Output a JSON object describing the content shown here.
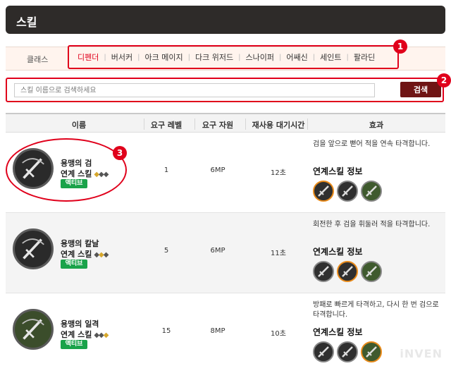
{
  "header": {
    "title": "스킬"
  },
  "classes": {
    "label": "클래스",
    "tabs": [
      "디펜더",
      "버서커",
      "아크 메이지",
      "다크 위저드",
      "스나이퍼",
      "어쌔신",
      "세인트",
      "팔라딘"
    ],
    "active_index": 0,
    "separator": "|"
  },
  "search": {
    "placeholder": "스킬 이름으로 검색하세요",
    "button_label": "검색"
  },
  "markers": [
    "1",
    "2",
    "3"
  ],
  "table": {
    "headers": [
      "이름",
      "요구 레벨",
      "요구 자원",
      "재사용 대기시간",
      "효과"
    ],
    "link_info_label": "연계스킬 정보",
    "rows": [
      {
        "name": "용맹의 검",
        "type": "연계 스킬",
        "badge": "액티브",
        "diamonds": [
          "gold",
          "gray",
          "gray"
        ],
        "level": "1",
        "resource": "6MP",
        "cooldown": "12초",
        "effect": "검을 앞으로 뻗어 적을 연속 타격합니다.",
        "selected_link": 0
      },
      {
        "name": "용맹의 칼날",
        "type": "연계 스킬",
        "badge": "액티브",
        "diamonds": [
          "gray",
          "gold",
          "gray"
        ],
        "level": "5",
        "resource": "6MP",
        "cooldown": "11초",
        "effect": "회전한 후 검을 휘둘러 적을 타격합니다.",
        "selected_link": 1
      },
      {
        "name": "용맹의 일격",
        "type": "연계 스킬",
        "badge": "액티브",
        "diamonds": [
          "gray",
          "gray",
          "gold"
        ],
        "level": "15",
        "resource": "8MP",
        "cooldown": "10초",
        "effect": "방패로 빠르게 타격하고, 다시 한 번 검으로 타격합니다.",
        "selected_link": 2
      }
    ]
  },
  "watermark": "iNVEN",
  "colors": {
    "accent_red": "#e0001b",
    "header_bg": "#2e2b29",
    "search_button": "#6f1414",
    "badge_green": "#1aa34a",
    "link_selected": "#e88a1a"
  }
}
